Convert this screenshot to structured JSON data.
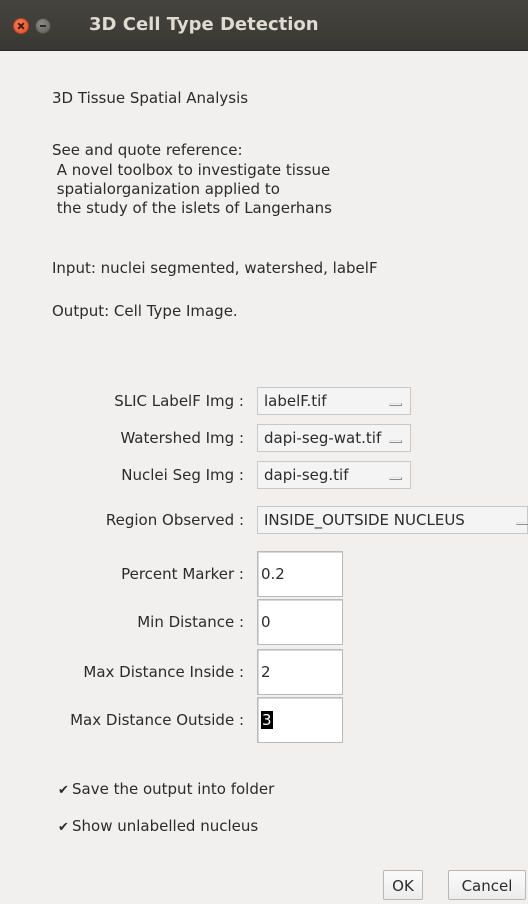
{
  "window": {
    "title": "3D Cell Type Detection"
  },
  "intro": {
    "heading": "3D Tissue Spatial Analysis",
    "reference_lines": [
      "See and quote reference:",
      " A novel toolbox to investigate tissue",
      " spatialorganization applied to",
      " the study of the islets of Langerhans"
    ],
    "input_text": "Input: nuclei segmented, watershed, labelF",
    "output_text": "Output: Cell Type Image."
  },
  "choices": [
    {
      "label": "SLIC LabelF Img :",
      "value": "labelF.tif"
    },
    {
      "label": "Watershed Img :",
      "value": "dapi-seg-wat.tif"
    },
    {
      "label": "Nuclei Seg Img :",
      "value": "dapi-seg.tif"
    },
    {
      "label": "Region Observed :",
      "value": "INSIDE_OUTSIDE NUCLEUS"
    }
  ],
  "fields": [
    {
      "label": "Percent Marker :",
      "value": "0.2"
    },
    {
      "label": "Min Distance :",
      "value": "0"
    },
    {
      "label": "Max Distance Inside :",
      "value": "2"
    },
    {
      "label": "Max Distance Outside :",
      "value": "3"
    }
  ],
  "checkboxes": [
    {
      "label": "Save the output into folder",
      "checked": true,
      "mark": "✔"
    },
    {
      "label": "Show unlabelled nucleus",
      "checked": true,
      "mark": "✔"
    }
  ],
  "buttons": {
    "ok": "OK",
    "cancel": "Cancel"
  },
  "colors": {
    "titlebar": "#3c3b37",
    "title_text": "#dfdbd2",
    "close_button": "#e95b33",
    "dialog_background": "#f1f0ee"
  }
}
